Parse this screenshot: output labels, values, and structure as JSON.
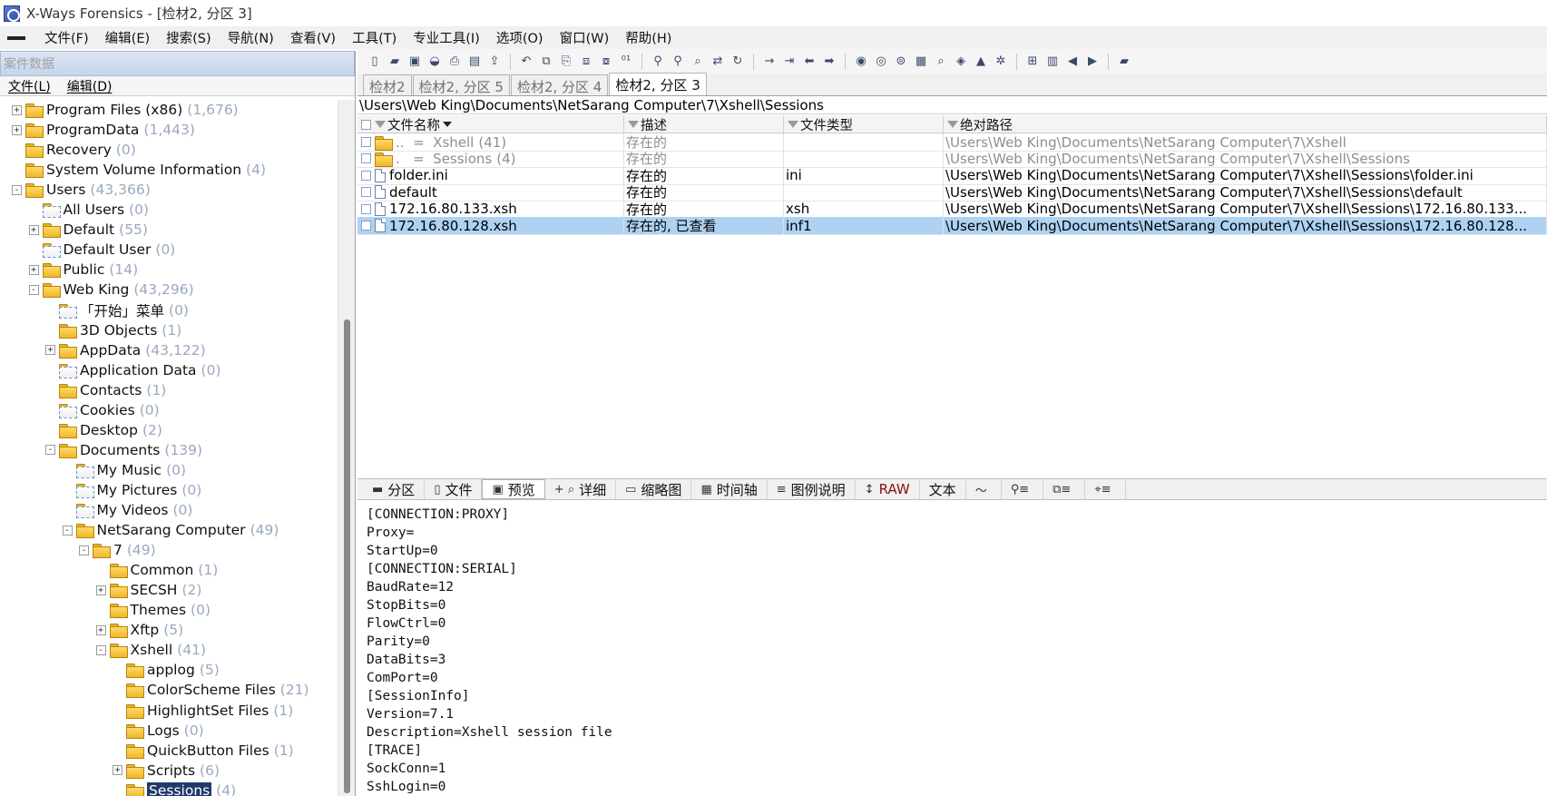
{
  "window": {
    "title": "X-Ways Forensics - [检材2, 分区 3]"
  },
  "menubar": {
    "items": [
      "文件(F)",
      "编辑(E)",
      "搜索(S)",
      "导航(N)",
      "查看(V)",
      "工具(T)",
      "专业工具(I)",
      "选项(O)",
      "窗口(W)",
      "帮助(H)"
    ]
  },
  "left_pane": {
    "header": "案件数据",
    "menu": [
      "文件(L)",
      "编辑(D)"
    ],
    "tree": [
      {
        "label": "Program Files (x86)",
        "count": "(1,676)",
        "level": 2,
        "exp": "+",
        "link": false
      },
      {
        "label": "ProgramData",
        "count": "(1,443)",
        "level": 2,
        "exp": "+",
        "link": false
      },
      {
        "label": "Recovery",
        "count": "(0)",
        "level": 2,
        "exp": "",
        "link": false
      },
      {
        "label": "System Volume Information",
        "count": "(4)",
        "level": 2,
        "exp": "",
        "link": false
      },
      {
        "label": "Users",
        "count": "(43,366)",
        "level": 2,
        "exp": "-",
        "link": false
      },
      {
        "label": "All Users",
        "count": "(0)",
        "level": 3,
        "exp": "",
        "link": true
      },
      {
        "label": "Default",
        "count": "(55)",
        "level": 3,
        "exp": "+",
        "link": false
      },
      {
        "label": "Default User",
        "count": "(0)",
        "level": 3,
        "exp": "",
        "link": true
      },
      {
        "label": "Public",
        "count": "(14)",
        "level": 3,
        "exp": "+",
        "link": false
      },
      {
        "label": "Web King",
        "count": "(43,296)",
        "level": 3,
        "exp": "-",
        "link": false
      },
      {
        "label": "「开始」菜单",
        "count": "(0)",
        "level": 4,
        "exp": "",
        "link": true
      },
      {
        "label": "3D Objects",
        "count": "(1)",
        "level": 4,
        "exp": "",
        "link": false
      },
      {
        "label": "AppData",
        "count": "(43,122)",
        "level": 4,
        "exp": "+",
        "link": false
      },
      {
        "label": "Application Data",
        "count": "(0)",
        "level": 4,
        "exp": "",
        "link": true
      },
      {
        "label": "Contacts",
        "count": "(1)",
        "level": 4,
        "exp": "",
        "link": false
      },
      {
        "label": "Cookies",
        "count": "(0)",
        "level": 4,
        "exp": "",
        "link": true
      },
      {
        "label": "Desktop",
        "count": "(2)",
        "level": 4,
        "exp": "",
        "link": false
      },
      {
        "label": "Documents",
        "count": "(139)",
        "level": 4,
        "exp": "-",
        "link": false
      },
      {
        "label": "My Music",
        "count": "(0)",
        "level": 5,
        "exp": "",
        "link": true
      },
      {
        "label": "My Pictures",
        "count": "(0)",
        "level": 5,
        "exp": "",
        "link": true
      },
      {
        "label": "My Videos",
        "count": "(0)",
        "level": 5,
        "exp": "",
        "link": true
      },
      {
        "label": "NetSarang Computer",
        "count": "(49)",
        "level": 5,
        "exp": "-",
        "link": false
      },
      {
        "label": "7",
        "count": "(49)",
        "level": 6,
        "exp": "-",
        "link": false
      },
      {
        "label": "Common",
        "count": "(1)",
        "level": 7,
        "exp": "",
        "link": false
      },
      {
        "label": "SECSH",
        "count": "(2)",
        "level": 7,
        "exp": "+",
        "link": false
      },
      {
        "label": "Themes",
        "count": "(0)",
        "level": 7,
        "exp": "",
        "link": false
      },
      {
        "label": "Xftp",
        "count": "(5)",
        "level": 7,
        "exp": "+",
        "link": false
      },
      {
        "label": "Xshell",
        "count": "(41)",
        "level": 7,
        "exp": "-",
        "link": false
      },
      {
        "label": "applog",
        "count": "(5)",
        "level": 8,
        "exp": "",
        "link": false
      },
      {
        "label": "ColorScheme Files",
        "count": "(21)",
        "level": 8,
        "exp": "",
        "link": false
      },
      {
        "label": "HighlightSet Files",
        "count": "(1)",
        "level": 8,
        "exp": "",
        "link": false
      },
      {
        "label": "Logs",
        "count": "(0)",
        "level": 8,
        "exp": "",
        "link": false
      },
      {
        "label": "QuickButton Files",
        "count": "(1)",
        "level": 8,
        "exp": "",
        "link": false
      },
      {
        "label": "Scripts",
        "count": "(6)",
        "level": 8,
        "exp": "+",
        "link": false
      },
      {
        "label": "Sessions",
        "count": "(4)",
        "level": 8,
        "exp": "",
        "link": false,
        "selected": true
      }
    ]
  },
  "tabs": [
    {
      "label": "检材2",
      "active": false
    },
    {
      "label": "检材2, 分区 5",
      "active": false
    },
    {
      "label": "检材2, 分区 4",
      "active": false
    },
    {
      "label": "检材2, 分区 3",
      "active": true
    }
  ],
  "path": "\\Users\\Web King\\Documents\\NetSarang Computer\\7\\Xshell\\Sessions",
  "grid": {
    "headers": [
      "文件名称",
      "描述",
      "文件类型",
      "绝对路径"
    ],
    "rows": [
      {
        "name": "..  =  Xshell",
        "count": "(41)",
        "desc": "存在的",
        "type": "",
        "path": "\\Users\\Web King\\Documents\\NetSarang Computer\\7\\Xshell",
        "icon": "folder",
        "gray": true
      },
      {
        "name": ".   =  Sessions",
        "count": "(4)",
        "desc": "存在的",
        "type": "",
        "path": "\\Users\\Web King\\Documents\\NetSarang Computer\\7\\Xshell\\Sessions",
        "icon": "folder",
        "gray": true
      },
      {
        "name": "folder.ini",
        "count": "",
        "desc": "存在的",
        "type": "ini",
        "path": "\\Users\\Web King\\Documents\\NetSarang Computer\\7\\Xshell\\Sessions\\folder.ini",
        "icon": "file",
        "gray": false
      },
      {
        "name": "default",
        "count": "",
        "desc": "存在的",
        "type": "",
        "path": "\\Users\\Web King\\Documents\\NetSarang Computer\\7\\Xshell\\Sessions\\default",
        "icon": "file",
        "gray": false
      },
      {
        "name": "172.16.80.133.xsh",
        "count": "",
        "desc": "存在的",
        "type": "xsh",
        "path": "\\Users\\Web King\\Documents\\NetSarang Computer\\7\\Xshell\\Sessions\\172.16.80.133...",
        "icon": "file",
        "gray": false
      },
      {
        "name": "172.16.80.128.xsh",
        "count": "",
        "desc": "存在的, 已查看",
        "type": "inf1",
        "path": "\\Users\\Web King\\Documents\\NetSarang Computer\\7\\Xshell\\Sessions\\172.16.80.128...",
        "icon": "file",
        "gray": false,
        "selected": true
      }
    ]
  },
  "bottom_tabs": [
    {
      "label": "分区",
      "icon": "▬"
    },
    {
      "label": "文件",
      "icon": "▯"
    },
    {
      "label": "预览",
      "icon": "▣",
      "active": true
    },
    {
      "label": "详细",
      "icon": "+ ⌕"
    },
    {
      "label": "缩略图",
      "icon": "▭"
    },
    {
      "label": "时间轴",
      "icon": "▦"
    },
    {
      "label": "图例说明",
      "icon": "≡"
    },
    {
      "label": "RAW",
      "icon": "↕",
      "raw": true
    },
    {
      "label": "文本",
      "icon": ""
    }
  ],
  "preview_lines": [
    "[CONNECTION:PROXY]",
    "Proxy=",
    "StartUp=0",
    "[CONNECTION:SERIAL]",
    "BaudRate=12",
    "StopBits=0",
    "FlowCtrl=0",
    "Parity=0",
    "DataBits=3",
    "ComPort=0",
    "[SessionInfo]",
    "Version=7.1",
    "Description=Xshell session file",
    "[TRACE]",
    "SockConn=1",
    "SshLogin=0"
  ]
}
